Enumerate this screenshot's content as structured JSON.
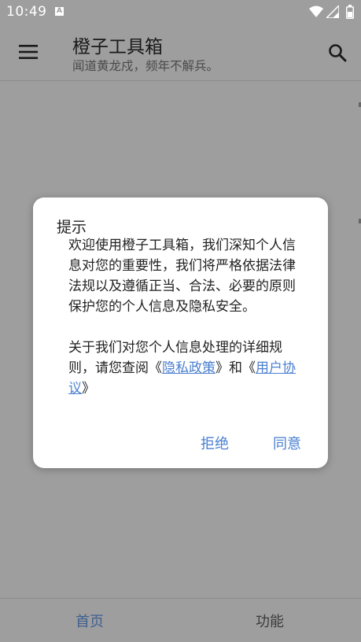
{
  "status_bar": {
    "time": "10:49",
    "notification_badge": "A"
  },
  "app_bar": {
    "title": "橙子工具箱",
    "subtitle": "闻道黄龙戍，频年不解兵。"
  },
  "dialog": {
    "title": "提示",
    "paragraph1": "欢迎使用橙子工具箱，我们深知个人信息对您的重要性，我们将严格依据法律法规以及遵循正当、合法、必要的原则保护您的个人信息及隐私安全。",
    "paragraph2_prefix": "关于我们对您个人信息处理的详细规则，请您查阅《",
    "privacy_link": "隐私政策",
    "paragraph2_middle": "》和《",
    "user_agreement_link": "用户协议",
    "paragraph2_suffix": "》",
    "reject_label": "拒绝",
    "agree_label": "同意"
  },
  "bottom_nav": {
    "tabs": [
      {
        "label": "首页",
        "active": true
      },
      {
        "label": "功能",
        "active": false
      }
    ]
  },
  "colors": {
    "accent": "#4a7fd0",
    "scrim_background": "#9e9e9e",
    "active_tab": "#3f5f8f"
  },
  "icons": {
    "menu": "menu-icon",
    "search": "search-icon",
    "wifi": "wifi-icon",
    "signal": "signal-icon",
    "battery": "battery-icon"
  }
}
